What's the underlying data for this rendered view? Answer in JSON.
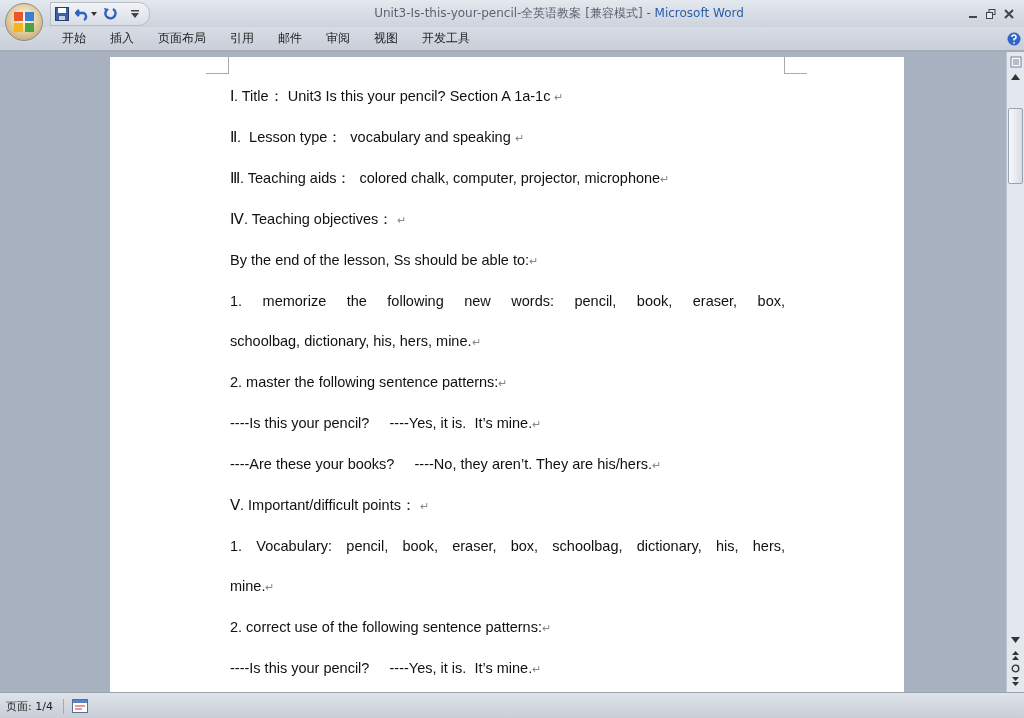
{
  "window": {
    "title": "Unit3-Is-this-your-pencil-全英语教案 [兼容模式]",
    "app_name": "- Microsoft Word"
  },
  "ribbon_tabs": [
    {
      "label": "开始"
    },
    {
      "label": "插入"
    },
    {
      "label": "页面布局"
    },
    {
      "label": "引用"
    },
    {
      "label": "邮件"
    },
    {
      "label": "审阅"
    },
    {
      "label": "视图"
    },
    {
      "label": "开发工具"
    }
  ],
  "document": {
    "paragraphs": [
      {
        "lines": [
          "Ⅰ. Title： Unit3 Is this your pencil? Section A 1a-1c "
        ],
        "mark": "↵"
      },
      {
        "lines": [
          "Ⅱ.  Lesson type：  vocabulary and speaking "
        ],
        "mark": "↵"
      },
      {
        "lines": [
          "Ⅲ. Teaching aids：  colored chalk, computer, projector, microphone"
        ],
        "mark": "↵"
      },
      {
        "lines": [
          "Ⅳ. Teaching objectives： "
        ],
        "mark": "↵"
      },
      {
        "lines": [
          "By the end of the lesson, Ss should be able to:"
        ],
        "mark": "↵"
      },
      {
        "lines": [
          "1. memorize the following new words: pencil, book, eraser, box,",
          "schoolbag, dictionary, his, hers, mine."
        ],
        "mark": "↵"
      },
      {
        "lines": [
          "2. master the following sentence patterns:"
        ],
        "mark": "↵"
      },
      {
        "lines": [
          "----Is this your pencil?     ----Yes, it is.  It’s mine."
        ],
        "mark": "↵"
      },
      {
        "lines": [
          "----Are these your books?     ----No, they aren’t. They are his/hers."
        ],
        "mark": "↵"
      },
      {
        "lines": [
          "Ⅴ. Important/difficult points： "
        ],
        "mark": "↵"
      },
      {
        "lines": [
          "1. Vocabulary: pencil, book, eraser, box, schoolbag, dictionary, his, hers,",
          "mine."
        ],
        "mark": "↵"
      },
      {
        "lines": [
          "2. correct use of the following sentence patterns:"
        ],
        "mark": "↵"
      },
      {
        "lines": [
          "----Is this your pencil?     ----Yes, it is.  It’s mine."
        ],
        "mark": "↵"
      }
    ]
  },
  "status_bar": {
    "page": "页面: 1/4"
  }
}
